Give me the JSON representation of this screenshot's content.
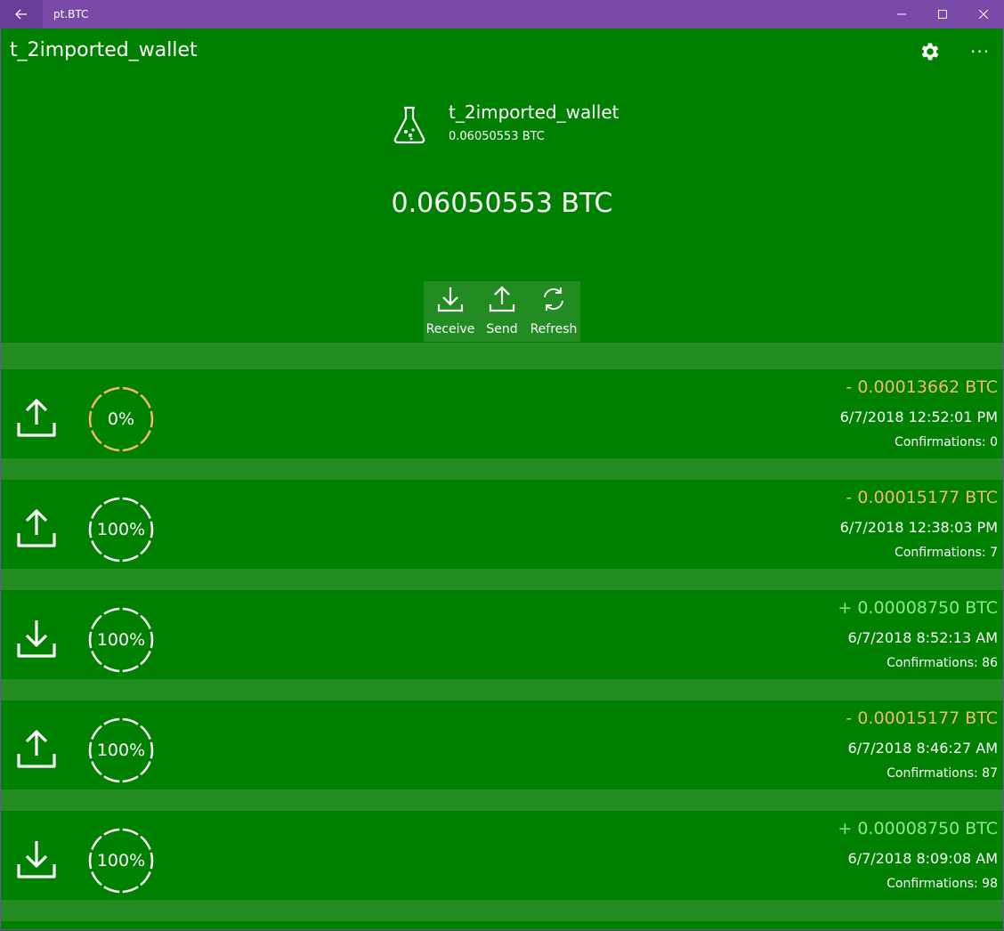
{
  "window": {
    "title": "pt.BTC"
  },
  "header": {
    "title": "t_2imported_wallet"
  },
  "wallet": {
    "name": "t_2imported_wallet",
    "balance_small": "0.06050553 BTC",
    "balance_big": "0.06050553 BTC"
  },
  "actions": {
    "receive": "Receive",
    "send": "Send",
    "refresh": "Refresh"
  },
  "transactions": [
    {
      "direction": "send",
      "percent": "0%",
      "amount": "- 0.00013662 BTC",
      "date": "6/7/2018 12:52:01 PM",
      "confirmations": "Confirmations: 0"
    },
    {
      "direction": "send",
      "percent": "100%",
      "amount": "- 0.00015177 BTC",
      "date": "6/7/2018 12:38:03 PM",
      "confirmations": "Confirmations: 7"
    },
    {
      "direction": "receive",
      "percent": "100%",
      "amount": "+ 0.00008750 BTC",
      "date": "6/7/2018 8:52:13 AM",
      "confirmations": "Confirmations: 86"
    },
    {
      "direction": "send",
      "percent": "100%",
      "amount": "- 0.00015177 BTC",
      "date": "6/7/2018 8:46:27 AM",
      "confirmations": "Confirmations: 87"
    },
    {
      "direction": "receive",
      "percent": "100%",
      "amount": "+ 0.00008750 BTC",
      "date": "6/7/2018 8:09:08 AM",
      "confirmations": "Confirmations: 98"
    }
  ],
  "colors": {
    "background": "#008000",
    "strip": "#228b22",
    "titlebar": "#7a4aa8",
    "outgoing": "#f0b870",
    "incoming": "#8ee88e"
  }
}
